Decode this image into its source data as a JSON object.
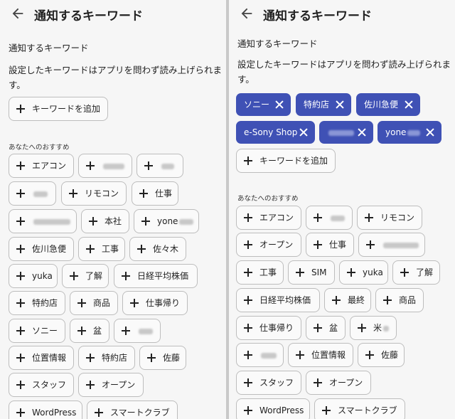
{
  "left": {
    "title": "通知するキーワード",
    "section": "通知するキーワード",
    "description": "設定したキーワードはアプリを問わず読み上げられます。",
    "add_button": "キーワードを追加",
    "recommend_label": "あなたへのおすすめ",
    "chips": [
      "エアコン",
      "",
      "",
      "",
      "リモコン",
      "仕事",
      "",
      "本社",
      "yone",
      "佐川急便",
      "工事",
      "佐々木",
      "yuka",
      "了解",
      "日経平均株価",
      "特約店",
      "商品",
      "仕事帰り",
      "ソニー",
      "盆",
      "",
      "位置情報",
      "特約店",
      "佐藤",
      "スタッフ",
      "オープン",
      "WordPress",
      "スマートクラブ"
    ]
  },
  "right": {
    "title": "通知するキーワード",
    "section": "通知するキーワード",
    "description": "設定したキーワードはアプリを問わず読み上げられます。",
    "selected": [
      "ソニー",
      "特約店",
      "佐川急便",
      "e-Sony Shop",
      "",
      "yone"
    ],
    "add_button": "キーワードを追加",
    "recommend_label": "あなたへのおすすめ",
    "chips": [
      "エアコン",
      "",
      "リモコン",
      "オープン",
      "仕事",
      "",
      "工事",
      "SIM",
      "yuka",
      "了解",
      "日経平均株価",
      "最終",
      "商品",
      "仕事帰り",
      "盆",
      "米",
      "",
      "位置情報",
      "佐藤",
      "スタッフ",
      "オープン",
      "WordPress",
      "スマートクラブ"
    ]
  },
  "colors": {
    "accent": "#3f51b5",
    "background": "#f6f6f6",
    "divider": "#c9c9c9"
  },
  "icons": {
    "back": "arrow-left-icon",
    "add": "plus-icon",
    "remove": "close-icon"
  }
}
